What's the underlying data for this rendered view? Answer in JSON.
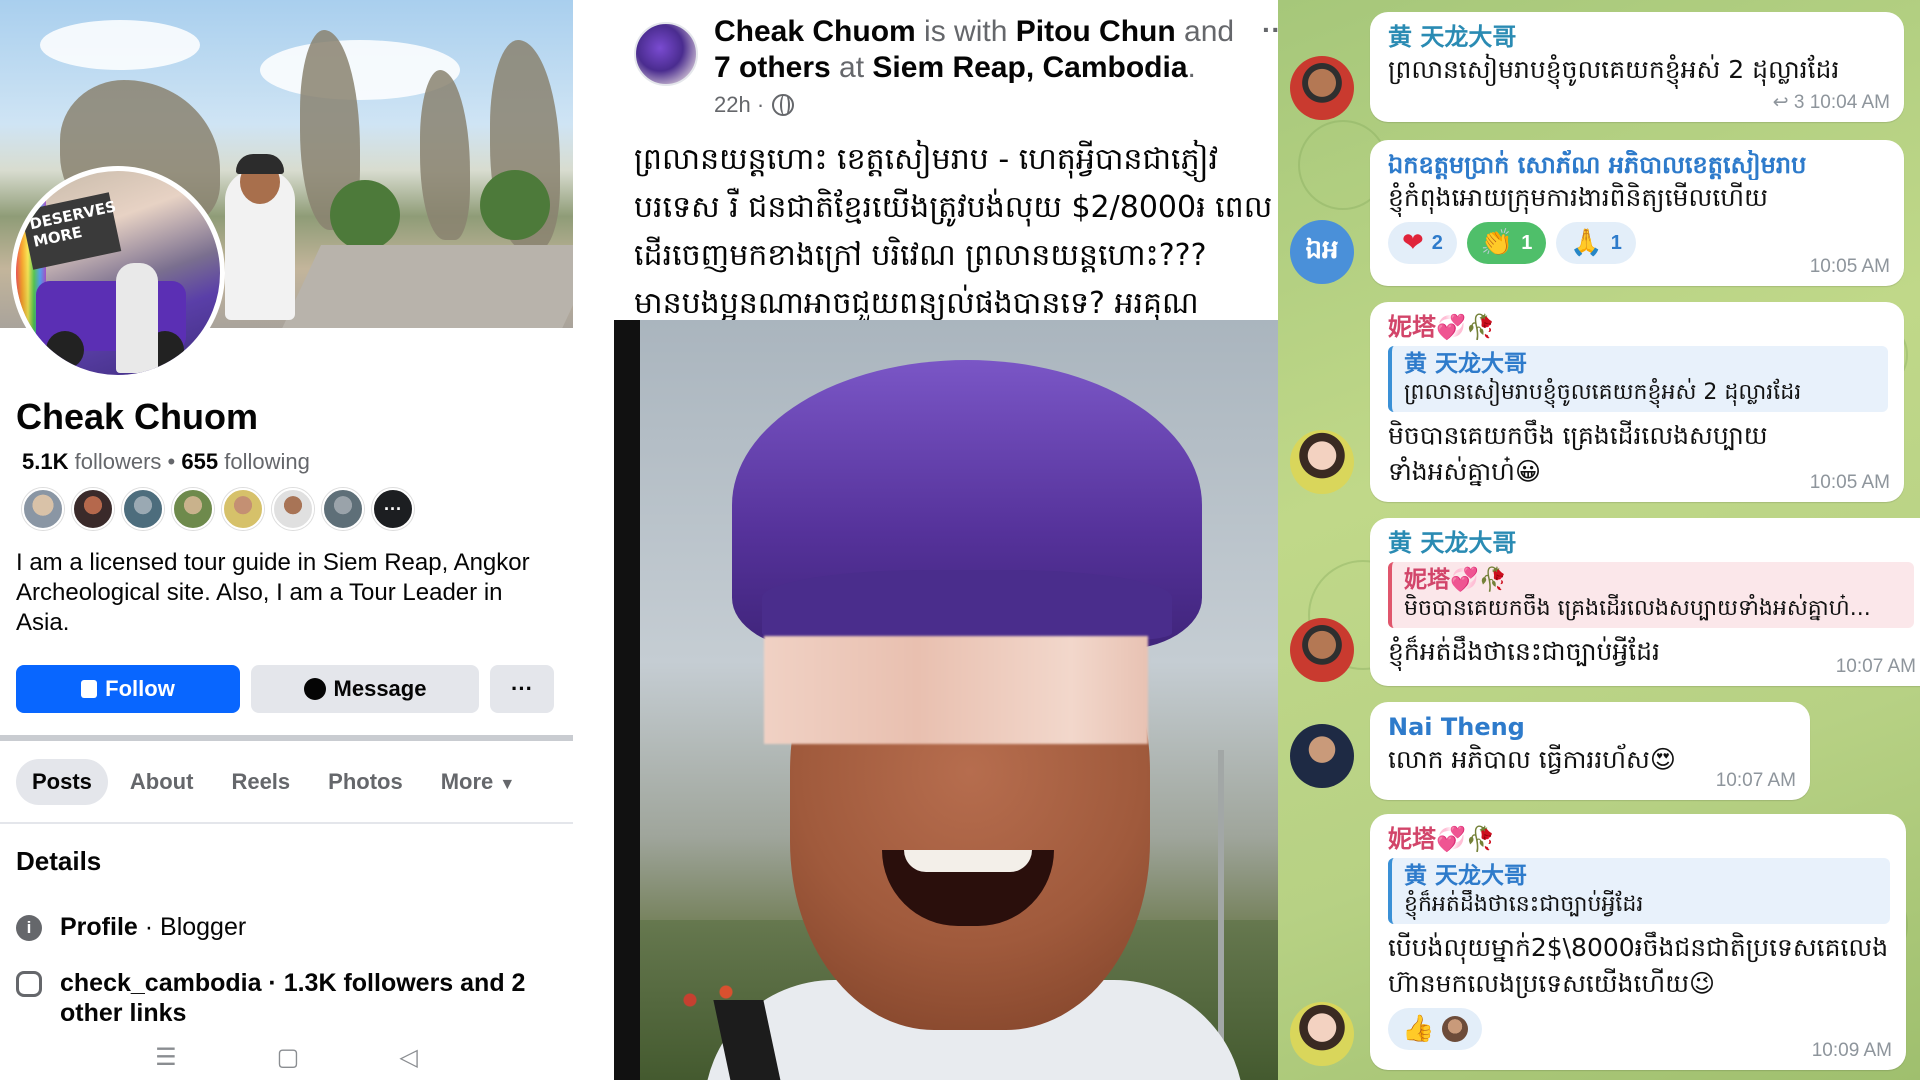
{
  "profile": {
    "name": "Cheak Chuom",
    "followers_count": "5.1K",
    "followers_label": "followers",
    "following_count": "655",
    "following_label": "following",
    "friends_more": "···",
    "bio": "I am a licensed tour guide in Siem Reap, Angkor Archeological site. Also, I am a Tour Leader in Asia.",
    "avatar_sign_text": "DESERVES MORE",
    "buttons": {
      "follow": "Follow",
      "message": "Message",
      "more": "···"
    },
    "tabs": [
      "Posts",
      "About",
      "Reels",
      "Photos",
      "More"
    ],
    "details_title": "Details",
    "detail_profile_label": "Profile",
    "detail_profile_value": " · Blogger",
    "detail_instagram": "check_cambodia · 1.3K followers and 2 other links",
    "colors": {
      "accent": "#0866ff"
    },
    "icons": [
      "info-icon",
      "instagram-icon",
      "lock-icon",
      "messenger-icon",
      "chevron-down-icon"
    ]
  },
  "post": {
    "author": "Cheak Chuom",
    "with_text": " is with ",
    "tagged": "Pitou Chun",
    "and_text": " and ",
    "others": "7 others",
    "at_text": " at ",
    "location": "Siem Reap, Cambodia",
    "period": ".",
    "time": "22h ·",
    "body": "ព្រលានយន្តហោះ ខេត្តសៀមរាប - ហេតុអ្វីបានជាភ្ញៀវបរទេស រឺ ជនជាតិខ្មែរយើងត្រូវបង់លុយ $2/8000៛ ពេលដើរចេញមកខាងក្រៅ បរិវេណ ព្រលានយន្តហោះ??? មានបងប្អូនណាអាចជួយពន្យល់ផងបានទេ? អរគុណ"
  },
  "chat": {
    "messages": [
      {
        "sender": "黄 天龙大哥",
        "text": "ព្រលានសៀមរាបខ្ញុំចូលគេយកខ្ញុំអស់ 2 ដុល្លារដែរ",
        "reply_count": "3",
        "time": "10:04 AM"
      },
      {
        "sender": "ឯកឧត្តមប្រាក់ សោភ័ណ អភិបាលខេត្តសៀមរាប",
        "text": "ខ្ញុំកំពុងអោយក្រុមការងារពិនិត្យមើលហើយ",
        "avatar_initials": "ឯអ",
        "reactions": [
          {
            "emoji": "❤",
            "count": "2"
          },
          {
            "emoji": "👏",
            "count": "1"
          },
          {
            "emoji": "🙏",
            "count": "1"
          }
        ],
        "time": "10:05 AM"
      },
      {
        "sender": "妮塔💞🥀",
        "quote_name": "黄 天龙大哥",
        "quote_text": "ព្រលានសៀមរាបខ្ញុំចូលគេយកខ្ញុំអស់ 2 ដុល្លារដែរ",
        "text": "មិចបានគេយកចឹង គ្រេងដើរលេងសប្បាយទាំងអស់គ្នាហ៎😀",
        "time": "10:05 AM"
      },
      {
        "sender": "黄 天龙大哥",
        "quote_name": "妮塔💞🥀",
        "quote_text": "មិចបានគេយកចឹង គ្រេងដើរលេងសប្បាយទាំងអស់គ្នាហ៎...",
        "text": "ខ្ញុំក៏អត់ដឹងថានេះជាច្បាប់អ្វីដែរ",
        "time": "10:07 AM"
      },
      {
        "sender": "Nai Theng",
        "text": "លោក អភិបាល ធ្វើការរហ័ស😍",
        "time": "10:07 AM"
      },
      {
        "sender": "妮塔💞🥀",
        "quote_name": "黄 天龙大哥",
        "quote_text": "ខ្ញុំក៏អត់ដឹងថានេះជាច្បាប់អ្វីដែរ",
        "text": "បើបង់លុយម្នាក់2$\\8000៛ចឹងជនជាតិប្រទេសគេលេងហ៊ានមកលេងប្រទេសយើងហើយ😉",
        "reactions": [
          {
            "emoji": "👍",
            "count": ""
          }
        ],
        "time": "10:09 AM"
      }
    ],
    "colors": {
      "sender_blue": "#2e7bcb",
      "sender_pink": "#d2456a",
      "sender_teal": "#2a8bb3"
    }
  }
}
